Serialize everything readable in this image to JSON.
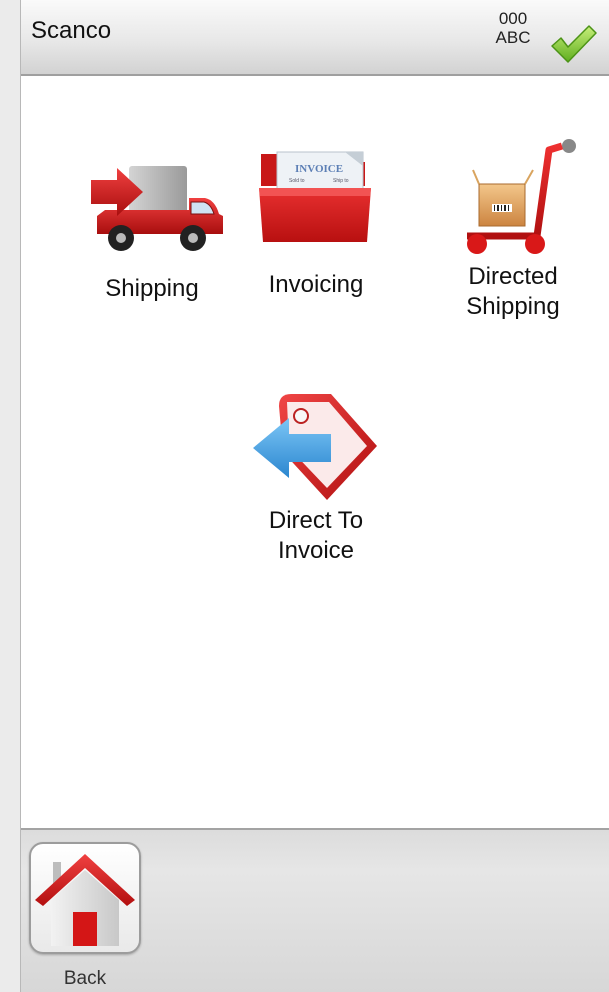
{
  "header": {
    "title": "Scanco",
    "status_line1": "000",
    "status_line2": "ABC",
    "status_icon": "checkmark-icon",
    "status_color": "#7fc832"
  },
  "menu": {
    "items": [
      {
        "label_line1": "Shipping",
        "label_line2": "",
        "icon": "truck-icon"
      },
      {
        "label_line1": "Invoicing",
        "label_line2": "",
        "icon": "folder-invoice-icon",
        "icon_text": "INVOICE",
        "icon_subtext_left": "Sold to",
        "icon_subtext_right": "Ship to"
      },
      {
        "label_line1": "Directed",
        "label_line2": "Shipping",
        "icon": "cart-icon"
      },
      {
        "label_line1": "Direct To",
        "label_line2": "Invoice",
        "icon": "tag-arrow-icon"
      }
    ]
  },
  "footer": {
    "back_label": "Back",
    "back_icon": "home-icon"
  },
  "colors": {
    "accent_red": "#d9191c",
    "accent_blue": "#3a9be0",
    "header_border": "#9f9f9f"
  }
}
